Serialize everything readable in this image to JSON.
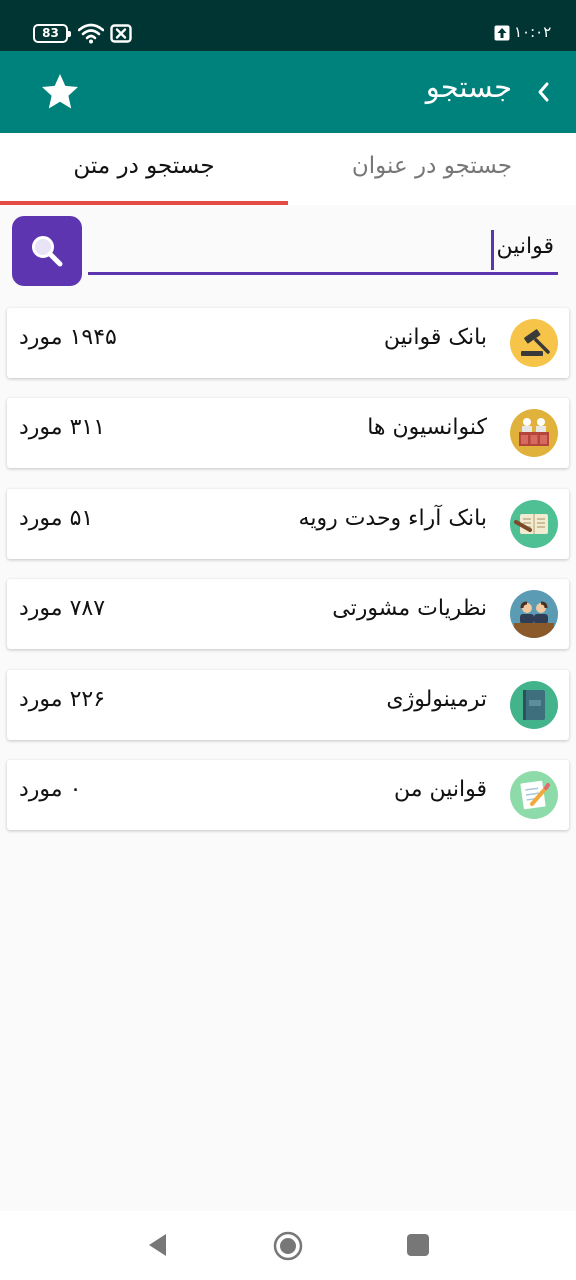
{
  "status_bar": {
    "battery": "83",
    "time": "۱۰:۰۲"
  },
  "app_bar": {
    "title": "جستجو"
  },
  "tabs": [
    {
      "label": "جستجو در عنوان",
      "selected": false
    },
    {
      "label": "جستجو در متن",
      "selected": true
    }
  ],
  "search": {
    "value": "قوانین",
    "button_icon": "search-icon"
  },
  "results": [
    {
      "label": "بانک قوانین",
      "count": "۱۹۴۵ مورد",
      "icon": "gavel-icon",
      "icon_color": "#f5c448"
    },
    {
      "label": "کنوانسیون ها",
      "count": "۳۱۱ مورد",
      "icon": "convention-icon",
      "icon_color": "#e0b23c"
    },
    {
      "label": "بانک آراء وحدت رویه",
      "count": "۵۱ مورد",
      "icon": "judgment-book-icon",
      "icon_color": "#4fbf94"
    },
    {
      "label": "نظریات مشورتی",
      "count": "۷۸۷ مورد",
      "icon": "consultants-icon",
      "icon_color": "#5b9bb3"
    },
    {
      "label": "ترمینولوژی",
      "count": "۲۲۶ مورد",
      "icon": "law-book-icon",
      "icon_color": "#43b38c"
    },
    {
      "label": "قوانین من",
      "count": "۰ مورد",
      "icon": "note-pencil-icon",
      "icon_color": "#8edbaa"
    }
  ],
  "colors": {
    "status_bar": "#003533",
    "app_bar": "#00827c",
    "accent": "#5e35b1",
    "tab_indicator": "#e64a45"
  }
}
